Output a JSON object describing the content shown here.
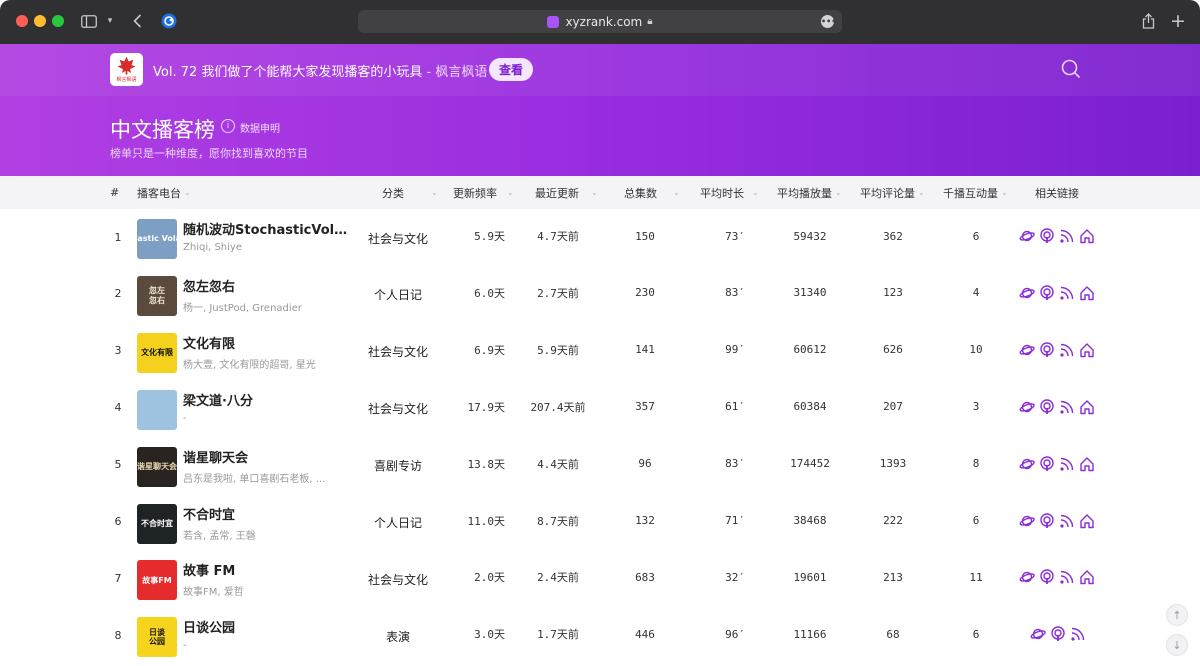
{
  "browser": {
    "url": "xyzrank.com"
  },
  "banner": {
    "promo_text": "Vol. 72 我们做了个能帮大家发现播客的小玩具",
    "promo_source": " - 枫言枫语",
    "view_button": "查看",
    "logo_text": "枫言枫语",
    "title": "中文播客榜",
    "data_note": "数据申明",
    "subtitle": "榜单只是一种维度，愿你找到喜欢的节目"
  },
  "columns": {
    "rank": "#",
    "name": "播客电台",
    "category": "分类",
    "frequency": "更新频率",
    "recent": "最近更新",
    "total": "总集数",
    "avg_length": "平均时长",
    "avg_plays": "平均播放量",
    "avg_comments": "平均评论量",
    "interaction": "千播互动量",
    "links": "相关链接"
  },
  "rows": [
    {
      "rank": "1",
      "name": "随机波动StochasticVolat...",
      "authors": "Zhiqi, Shiye",
      "category": "社会与文化",
      "frequency": "5.9天",
      "recent": "4.7天前",
      "total": "150",
      "avg_length": "73′",
      "avg_plays": "59432",
      "avg_comments": "362",
      "interaction": "6",
      "cover_text": "Stochastic Volatility",
      "cover_bg": "#7e9fc4"
    },
    {
      "rank": "2",
      "name": "忽左忽右",
      "authors": "杨一, JustPod, Grenadier",
      "category": "个人日记",
      "frequency": "6.0天",
      "recent": "2.7天前",
      "total": "230",
      "avg_length": "83′",
      "avg_plays": "31340",
      "avg_comments": "123",
      "interaction": "4",
      "cover_text": "忽左\n忽右",
      "cover_bg": "#5b4b3f"
    },
    {
      "rank": "3",
      "name": "文化有限",
      "authors": "杨大壹, 文化有限的超哥, 星光",
      "category": "社会与文化",
      "frequency": "6.9天",
      "recent": "5.9天前",
      "total": "141",
      "avg_length": "99′",
      "avg_plays": "60612",
      "avg_comments": "626",
      "interaction": "10",
      "cover_text": "文化有限",
      "cover_bg": "#f4d11c"
    },
    {
      "rank": "4",
      "name": "梁文道·八分",
      "authors": "-",
      "category": "社会与文化",
      "frequency": "17.9天",
      "recent": "207.4天前",
      "total": "357",
      "avg_length": "61′",
      "avg_plays": "60384",
      "avg_comments": "207",
      "interaction": "3",
      "cover_text": "",
      "cover_bg": "#9ec3e0"
    },
    {
      "rank": "5",
      "name": "谐星聊天会",
      "authors": "吕东是我啦, 单口喜剧石老板, ...",
      "category": "喜剧专访",
      "frequency": "13.8天",
      "recent": "4.4天前",
      "total": "96",
      "avg_length": "83′",
      "avg_plays": "174452",
      "avg_comments": "1393",
      "interaction": "8",
      "cover_text": "谐星聊天会",
      "cover_bg": "#2a2420"
    },
    {
      "rank": "6",
      "name": "不合时宜",
      "authors": "若含, 孟常, 王磬",
      "category": "个人日记",
      "frequency": "11.0天",
      "recent": "8.7天前",
      "total": "132",
      "avg_length": "71′",
      "avg_plays": "38468",
      "avg_comments": "222",
      "interaction": "6",
      "cover_text": "不合时宜",
      "cover_bg": "#1e2326"
    },
    {
      "rank": "7",
      "name": "故事 FM",
      "authors": "故事FM, 爱哲",
      "category": "社会与文化",
      "frequency": "2.0天",
      "recent": "2.4天前",
      "total": "683",
      "avg_length": "32′",
      "avg_plays": "19601",
      "avg_comments": "213",
      "interaction": "11",
      "cover_text": "故事FM",
      "cover_bg": "#e52b2b"
    },
    {
      "rank": "8",
      "name": "日谈公园",
      "authors": "-",
      "category": "表演",
      "frequency": "3.0天",
      "recent": "1.7天前",
      "total": "446",
      "avg_length": "96′",
      "avg_plays": "11166",
      "avg_comments": "68",
      "interaction": "6",
      "cover_text": "日谈\n公园",
      "cover_bg": "#f6d31d"
    }
  ],
  "colors": {
    "accent": "#9b2ee0",
    "link_icon": "#8b2bd8"
  }
}
